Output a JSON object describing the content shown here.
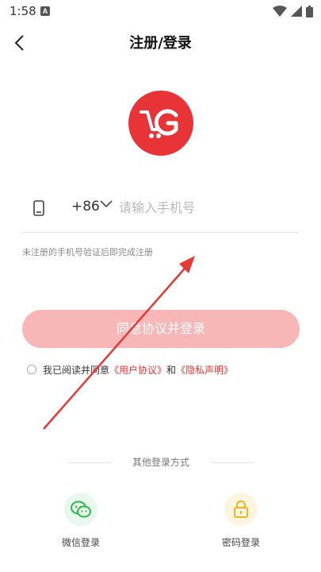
{
  "status_bar": {
    "time": "1:58",
    "notification_letter": "A"
  },
  "nav": {
    "title": "注册/登录"
  },
  "phone": {
    "country_code": "+86",
    "placeholder": "请输入手机号",
    "value": ""
  },
  "hint": "未注册的手机号验证后即完成注册",
  "login_button": "同意协议并登录",
  "agreement": {
    "prefix": "我已阅读并同意",
    "user_agreement": "《用户协议》",
    "conjunction": "和",
    "privacy": "《隐私声明》",
    "checked": false
  },
  "other_login": {
    "title": "其他登录方式",
    "wechat_label": "微信登录",
    "password_label": "密码登录"
  },
  "colors": {
    "brand": "#e83337",
    "button_disabled": "#f7b7b7",
    "wechat": "#2fb84a",
    "lock": "#f2b322"
  }
}
